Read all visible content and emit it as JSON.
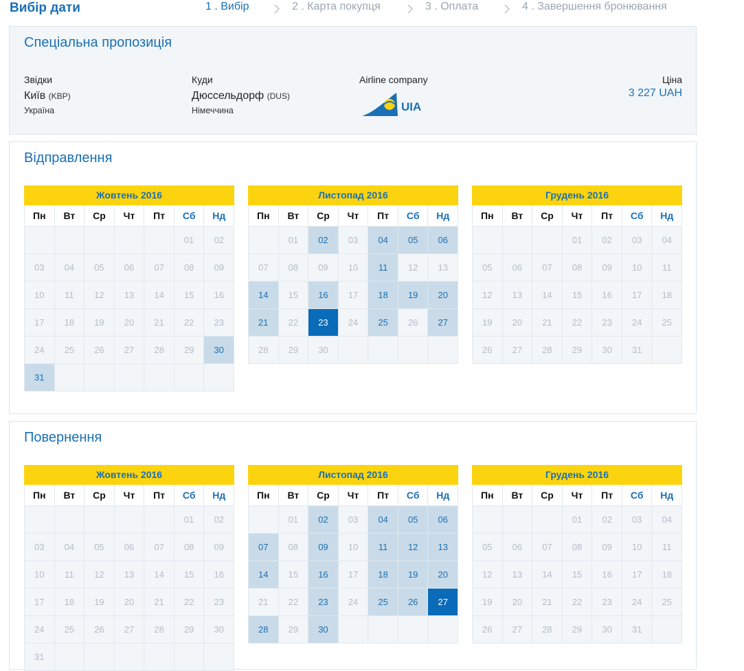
{
  "page_title": "Вибір дати",
  "steps": [
    {
      "label": "1 . Вибір",
      "active": true
    },
    {
      "label": "2 . Карта покупця",
      "active": false
    },
    {
      "label": "3 . Оплата",
      "active": false
    },
    {
      "label": "4 . Завершення бронювання",
      "active": false
    }
  ],
  "offer": {
    "title": "Спеціальна пропозиція",
    "from_label": "Звідки",
    "from_city": "Київ",
    "from_code": "(KBP)",
    "from_country": "Україна",
    "to_label": "Куди",
    "to_city": "Дюссельдорф",
    "to_code": "(DUS)",
    "to_country": "Німеччина",
    "airline_label": "Airline company",
    "airline_logo_text": "UIA",
    "price_label": "Ціна",
    "price": "3 227 UAH"
  },
  "departure": {
    "title": "Відправлення",
    "months": [
      {
        "name": "Жовтень 2016",
        "offset": 5,
        "days": 31,
        "avail": [
          30,
          31
        ],
        "selected": null,
        "inactive_all": true
      },
      {
        "name": "Листопад 2016",
        "offset": 1,
        "days": 30,
        "avail": [
          2,
          4,
          5,
          6,
          11,
          14,
          16,
          18,
          19,
          20,
          21,
          25,
          27
        ],
        "selected": 23,
        "inactive_all": false
      },
      {
        "name": "Грудень 2016",
        "offset": 3,
        "days": 31,
        "avail": [],
        "selected": null,
        "inactive_all": true
      }
    ]
  },
  "return": {
    "title": "Повернення",
    "months": [
      {
        "name": "Жовтень 2016",
        "offset": 5,
        "days": 31,
        "avail": [],
        "selected": null,
        "inactive_all": true
      },
      {
        "name": "Листопад 2016",
        "offset": 1,
        "days": 30,
        "avail": [
          2,
          4,
          5,
          6,
          7,
          9,
          11,
          12,
          13,
          14,
          16,
          18,
          19,
          20,
          23,
          25,
          26,
          28,
          30
        ],
        "selected": 27,
        "inactive_all": false
      },
      {
        "name": "Грудень 2016",
        "offset": 3,
        "days": 31,
        "avail": [],
        "selected": null,
        "inactive_all": true
      }
    ]
  },
  "weekdays": [
    "Пн",
    "Вт",
    "Ср",
    "Чт",
    "Пт",
    "Сб",
    "Нд"
  ],
  "colors": {
    "accent": "#1a6fb5",
    "header_yellow": "#fbd40f",
    "available": "#c9dbe8",
    "selected": "#0a6bb8"
  }
}
